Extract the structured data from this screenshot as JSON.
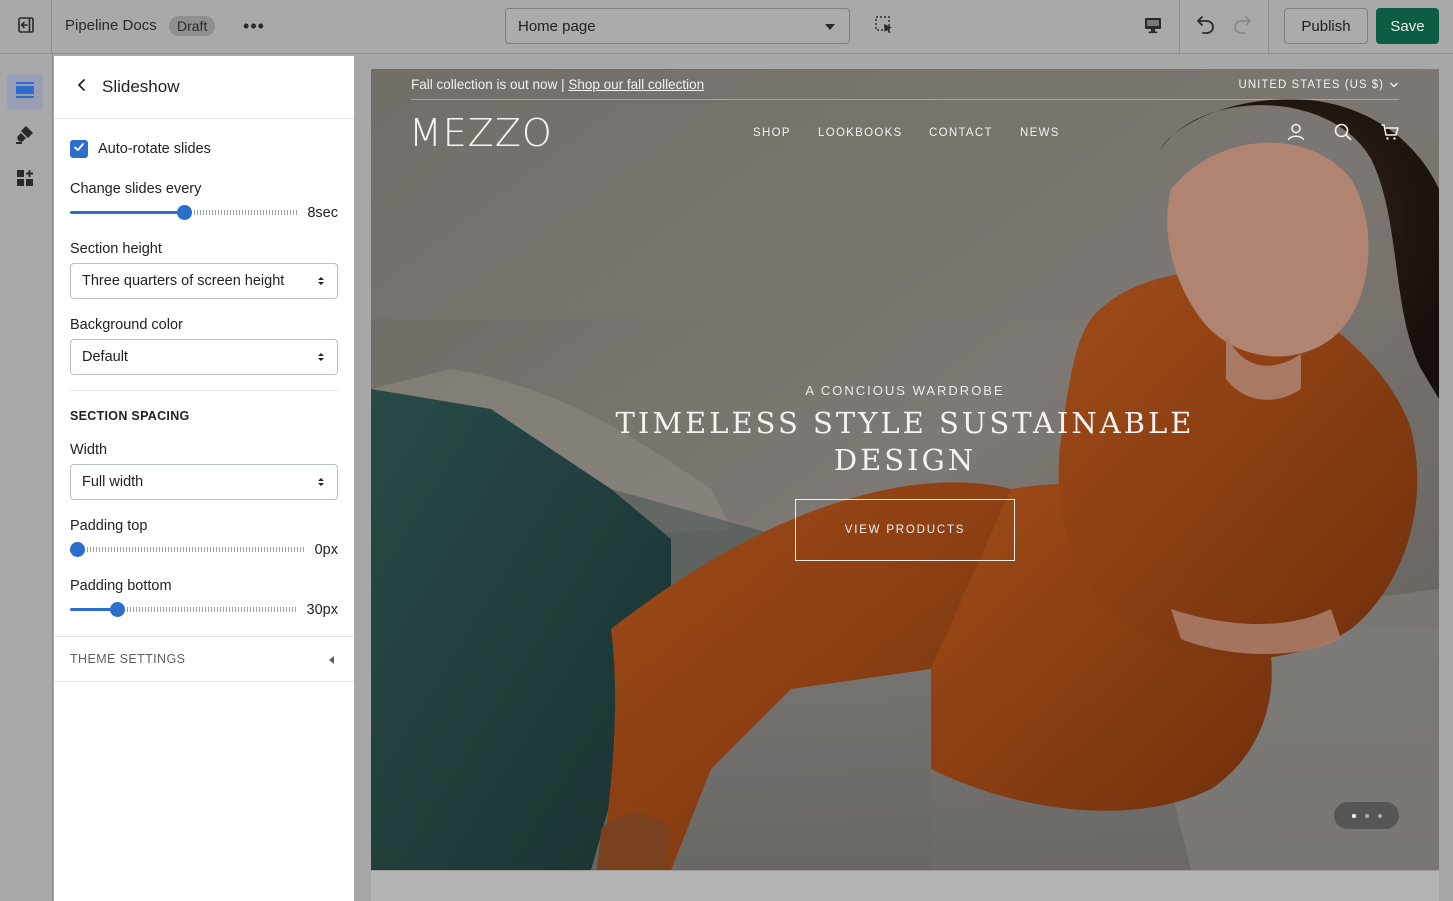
{
  "topbar": {
    "store_name": "Pipeline Docs",
    "status_badge": "Draft",
    "more_label": "•••",
    "page_select": "Home page",
    "publish_label": "Publish",
    "save_label": "Save"
  },
  "rail": {
    "items": [
      {
        "icon": "sections-icon",
        "active": true
      },
      {
        "icon": "theme-brush-icon",
        "active": false
      },
      {
        "icon": "app-blocks-icon",
        "active": false
      }
    ]
  },
  "panel": {
    "title": "Slideshow",
    "auto_rotate": {
      "label": "Auto-rotate slides",
      "checked": true
    },
    "change_slides": {
      "label": "Change slides every",
      "value": "8sec",
      "fraction": 0.5
    },
    "section_height": {
      "label": "Section height",
      "value": "Three quarters of screen height"
    },
    "background_color": {
      "label": "Background color",
      "value": "Default"
    },
    "spacing_heading": "SECTION SPACING",
    "width": {
      "label": "Width",
      "value": "Full width"
    },
    "padding_top": {
      "label": "Padding top",
      "value": "0px",
      "fraction": 0.0
    },
    "padding_bottom": {
      "label": "Padding bottom",
      "value": "30px",
      "fraction": 0.19
    },
    "theme_settings": "THEME SETTINGS"
  },
  "preview": {
    "announcement_text": "Fall collection is out now | ",
    "announcement_link": "Shop our fall collection",
    "country": "UNITED STATES (US $)",
    "logo": "MEZZO",
    "nav": [
      "SHOP",
      "LOOKBOOKS",
      "CONTACT",
      "NEWS"
    ],
    "eyebrow": "A CONCIOUS WARDROBE",
    "headline": "TIMELESS STYLE SUSTAINABLE DESIGN",
    "cta": "VIEW PRODUCTS",
    "slide_count": 3,
    "active_slide": 1
  },
  "colors": {
    "accent": "#2c6ecb",
    "save": "#0d5d45",
    "garment": "#b5531c"
  }
}
